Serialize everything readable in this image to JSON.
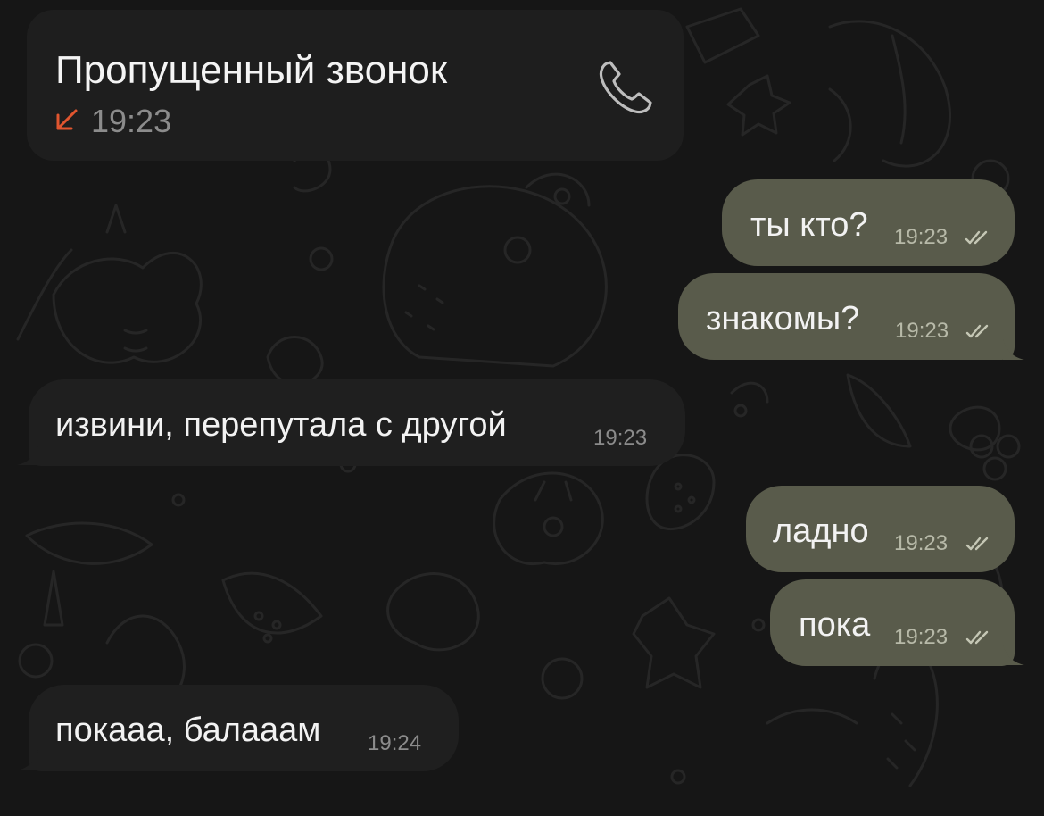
{
  "colors": {
    "background": "#161616",
    "incoming_bubble": "#1f1f1f",
    "outgoing_bubble": "#595b4b",
    "missed_call_accent": "#e0552f"
  },
  "call": {
    "title": "Пропущенный звонок",
    "time": "19:23",
    "direction_icon": "missed-call-arrow-icon",
    "action_icon": "phone-icon"
  },
  "messages": [
    {
      "text": "ты кто?",
      "time": "19:23",
      "outgoing": true,
      "status_icon": "double-check-icon"
    },
    {
      "text": "знакомы?",
      "time": "19:23",
      "outgoing": true,
      "status_icon": "double-check-icon"
    },
    {
      "text": "извини, перепутала с другой",
      "time": "19:23",
      "outgoing": false
    },
    {
      "text": "ладно",
      "time": "19:23",
      "outgoing": true,
      "status_icon": "double-check-icon"
    },
    {
      "text": "пока",
      "time": "19:23",
      "outgoing": true,
      "status_icon": "double-check-icon"
    },
    {
      "text": "покааа, балааам",
      "time": "19:24",
      "outgoing": false
    }
  ]
}
